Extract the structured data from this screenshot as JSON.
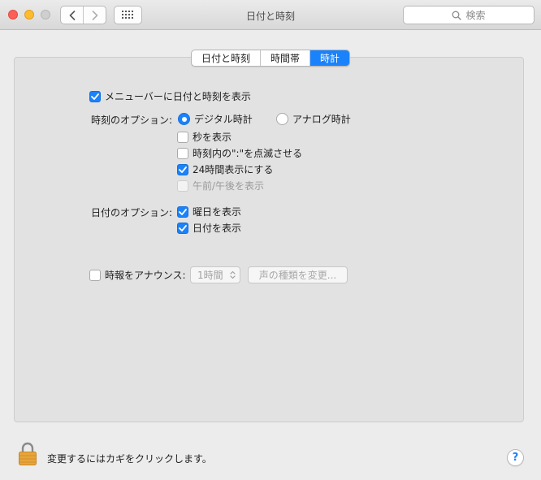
{
  "window": {
    "title": "日付と時刻",
    "search_placeholder": "検索"
  },
  "tabs": [
    {
      "label": "日付と時刻",
      "active": false
    },
    {
      "label": "時間帯",
      "active": false
    },
    {
      "label": "時計",
      "active": true
    }
  ],
  "menubar_option": {
    "label": "メニューバーに日付と時刻を表示",
    "checked": true
  },
  "time_options": {
    "label": "時刻のオプション:",
    "digital": {
      "label": "デジタル時計",
      "selected": true
    },
    "analog": {
      "label": "アナログ時計",
      "selected": false
    },
    "show_seconds": {
      "label": "秒を表示",
      "checked": false
    },
    "flash_separators": {
      "label": "時刻内の\":\"を点滅させる",
      "checked": false
    },
    "use_24_hour": {
      "label": "24時間表示にする",
      "checked": true
    },
    "show_ampm": {
      "label": "午前/午後を表示",
      "checked": false,
      "disabled": true
    }
  },
  "date_options": {
    "label": "日付のオプション:",
    "show_day": {
      "label": "曜日を表示",
      "checked": true
    },
    "show_date": {
      "label": "日付を表示",
      "checked": true
    }
  },
  "announce": {
    "label": "時報をアナウンス:",
    "checked": false,
    "interval": "1時間",
    "voice_button": "声の種類を変更..."
  },
  "footer": {
    "lock_text": "変更するにはカギをクリックします。",
    "help": "?"
  },
  "colors": {
    "accent": "#1a82fb",
    "lock": "#e7a53a"
  }
}
